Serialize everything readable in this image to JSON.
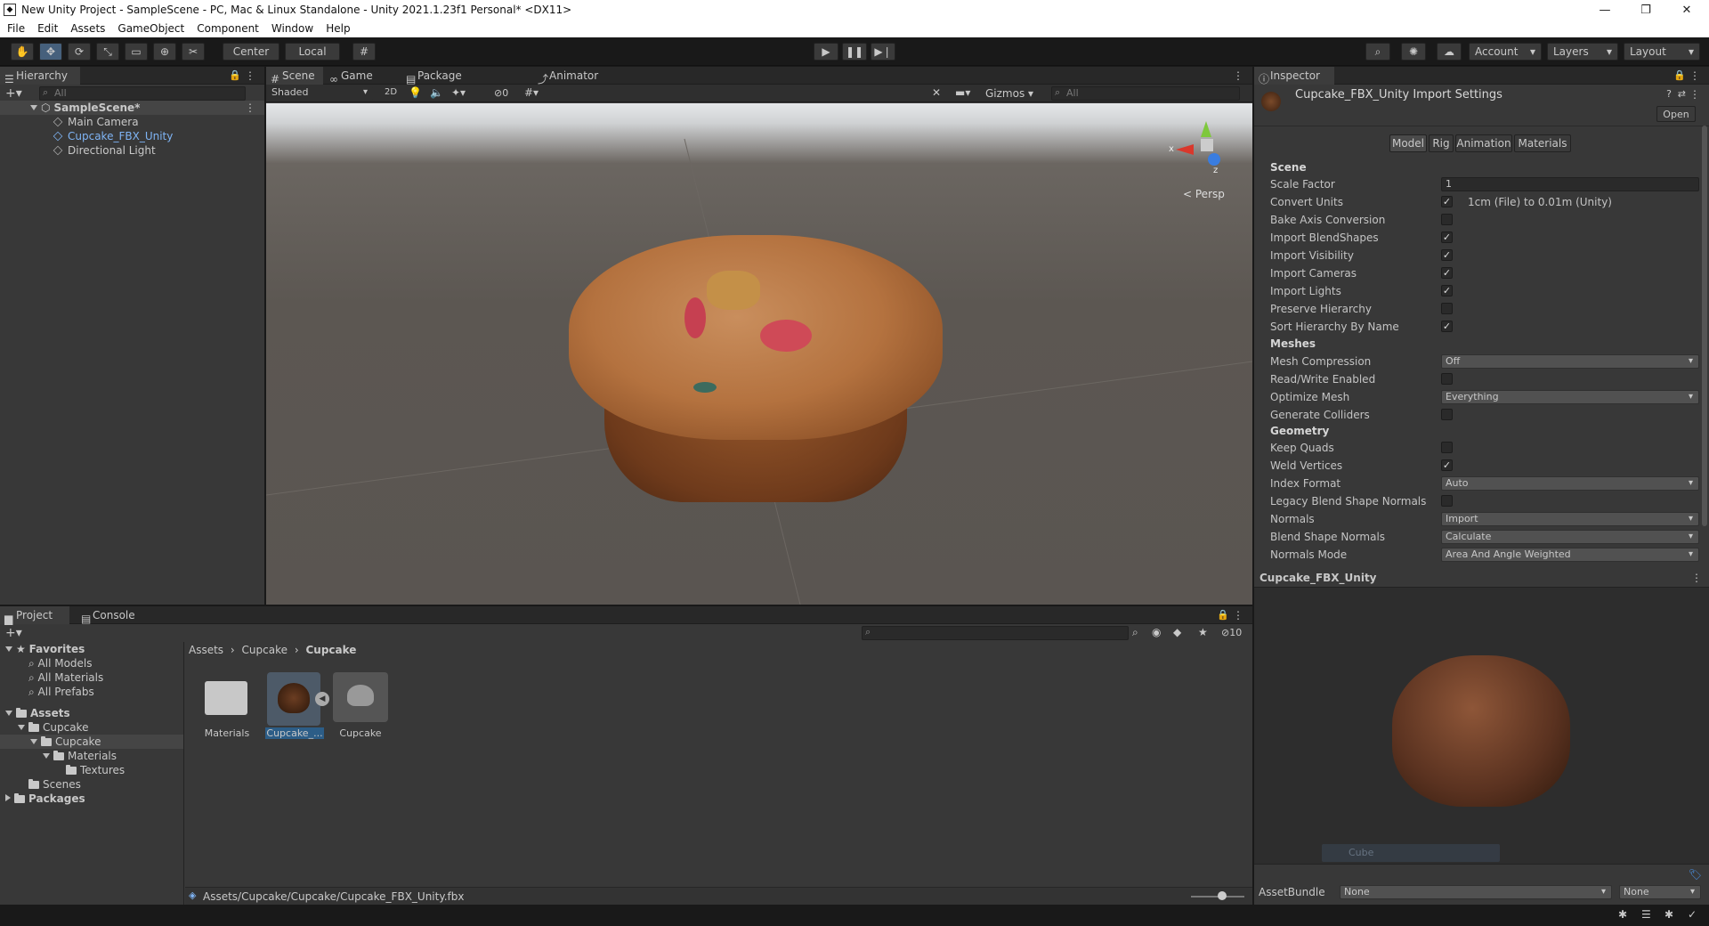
{
  "window": {
    "title": "New Unity Project - SampleScene - PC, Mac & Linux Standalone - Unity 2021.1.23f1 Personal* <DX11>"
  },
  "menu": [
    "File",
    "Edit",
    "Assets",
    "GameObject",
    "Component",
    "Window",
    "Help"
  ],
  "toolbar": {
    "center": "Center",
    "local": "Local",
    "account": "Account",
    "layers": "Layers",
    "layout": "Layout"
  },
  "hierarchy": {
    "tab": "Hierarchy",
    "search_placeholder": "All",
    "scene": "SampleScene*",
    "items": [
      "Main Camera",
      "Cupcake_FBX_Unity",
      "Directional Light"
    ]
  },
  "scene_view": {
    "tabs": [
      "Scene",
      "Game",
      "Package Manager",
      "Animator"
    ],
    "shading": "Shaded",
    "mode_2d": "2D",
    "hidden_count": "0",
    "gizmos": "Gizmos",
    "search_placeholder": "All",
    "persp": "Persp",
    "axis_x": "x",
    "axis_z": "z"
  },
  "inspector": {
    "tab": "Inspector",
    "title": "Cupcake_FBX_Unity Import Settings",
    "open": "Open",
    "subtabs": [
      "Model",
      "Rig",
      "Animation",
      "Materials"
    ],
    "sections": {
      "scene": "Scene",
      "meshes": "Meshes",
      "geometry": "Geometry"
    },
    "scale_factor_label": "Scale Factor",
    "scale_factor": "1",
    "convert_units_label": "Convert Units",
    "convert_units_note": "1cm (File) to 0.01m (Unity)",
    "bake_axis": "Bake Axis Conversion",
    "import_blendshapes": "Import BlendShapes",
    "import_visibility": "Import Visibility",
    "import_cameras": "Import Cameras",
    "import_lights": "Import Lights",
    "preserve_hierarchy": "Preserve Hierarchy",
    "sort_hierarchy": "Sort Hierarchy By Name",
    "mesh_compression_label": "Mesh Compression",
    "mesh_compression": "Off",
    "read_write": "Read/Write Enabled",
    "optimize_mesh_label": "Optimize Mesh",
    "optimize_mesh": "Everything",
    "generate_colliders": "Generate Colliders",
    "keep_quads": "Keep Quads",
    "weld_vertices": "Weld Vertices",
    "index_format_label": "Index Format",
    "index_format": "Auto",
    "legacy_blend": "Legacy Blend Shape Normals",
    "normals_label": "Normals",
    "normals": "Import",
    "blend_normals_label": "Blend Shape Normals",
    "blend_normals": "Calculate",
    "normals_mode_label": "Normals Mode",
    "normals_mode": "Area And Angle Weighted",
    "preview_title": "Cupcake_FBX_Unity",
    "preview_overlay": "Cube",
    "assetbundle_label": "AssetBundle",
    "assetbundle": "None",
    "assetbundle_variant": "None"
  },
  "project": {
    "tabs": [
      "Project",
      "Console"
    ],
    "hidden_count": "10",
    "favorites": "Favorites",
    "fav_items": [
      "All Models",
      "All Materials",
      "All Prefabs"
    ],
    "assets": "Assets",
    "tree": [
      "Cupcake",
      "Cupcake",
      "Materials",
      "Textures",
      "Scenes"
    ],
    "packages": "Packages",
    "breadcrumb": [
      "Assets",
      "Cupcake",
      "Cupcake"
    ],
    "files": [
      "Materials",
      "Cupcake_...",
      "Cupcake"
    ],
    "path": "Assets/Cupcake/Cupcake/Cupcake_FBX_Unity.fbx"
  },
  "colors": {
    "accent": "#46607c",
    "selection": "#2c5d87",
    "link": "#7fb4f5"
  }
}
